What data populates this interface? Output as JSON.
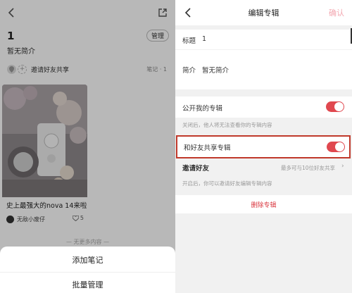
{
  "left": {
    "album_title": "1",
    "manage_label": "管理",
    "subtitle": "暂无简介",
    "invite_text": "邀请好友共享",
    "note_count": "笔记 · 1",
    "card": {
      "caption": "史上最强大的nova 14来啦",
      "author": "无敌小废仔",
      "likes": "5"
    },
    "no_more": "— 无更多内容 —",
    "sheet": {
      "add_note": "添加笔记",
      "batch_manage": "批量管理"
    }
  },
  "right": {
    "page_title": "编辑专辑",
    "confirm": "确认",
    "title_label": "标题",
    "title_value": "1",
    "intro_label": "简介",
    "intro_value": "暂无简介",
    "public_label": "公开我的专辑",
    "public_hint": "关闭后，他人将无法查看你的专辑内容",
    "share_label": "和好友共享专辑",
    "invite_label": "邀请好友",
    "invite_hint_right": "最多可与10位好友共享",
    "share_hint": "开启后，你可以邀请好友编辑专辑内容",
    "delete_label": "删除专辑"
  },
  "colors": {
    "accent_red": "#e0484f",
    "confirm_disabled": "#f3a7b0",
    "highlight_border": "#c0392b"
  },
  "toggles": {
    "public_album": true,
    "share_with_friends": true
  }
}
